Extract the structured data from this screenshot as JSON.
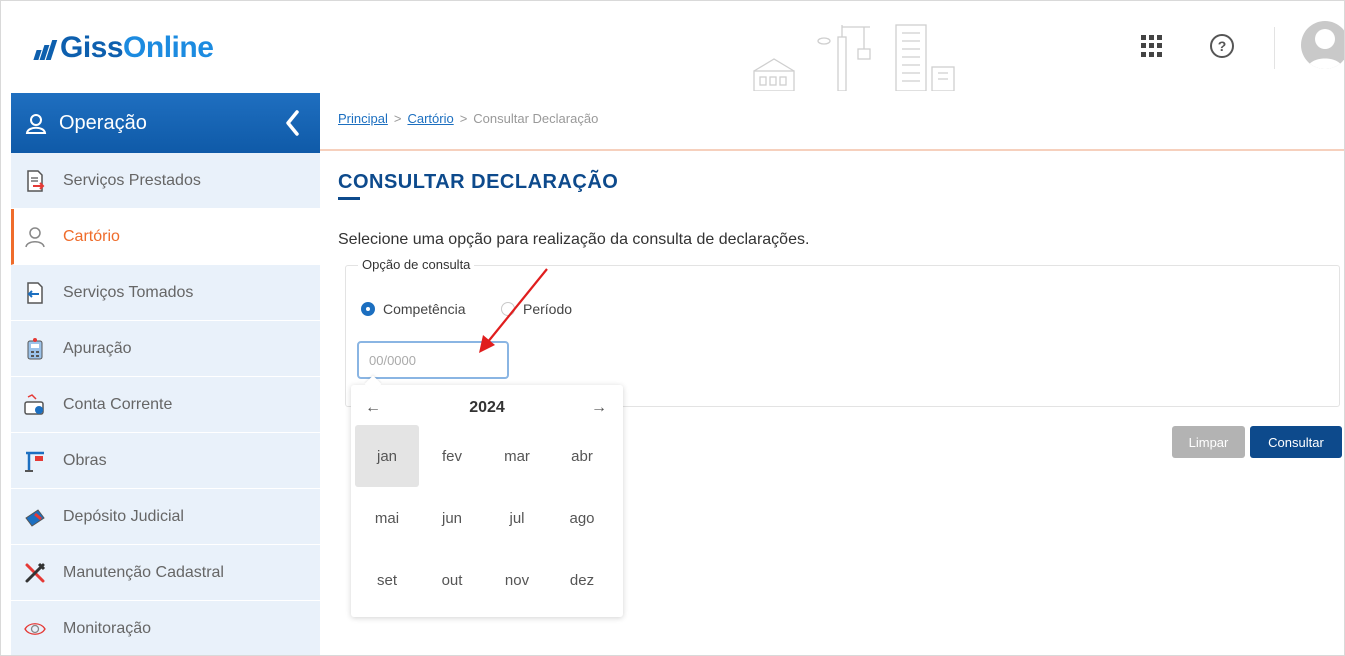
{
  "header": {
    "logo_prefix": "Giss",
    "logo_suffix": "Online",
    "apps_icon": "grid-icon",
    "help_label": "?",
    "avatar_icon": "user-avatar"
  },
  "sidebar": {
    "section_label": "Operação",
    "items": [
      {
        "label": "Serviços Prestados",
        "icon": "document-arrow-icon",
        "active": false
      },
      {
        "label": "Cartório",
        "icon": "person-icon",
        "active": true
      },
      {
        "label": "Serviços Tomados",
        "icon": "document-arrow-in-icon",
        "active": false
      },
      {
        "label": "Apuração",
        "icon": "calculator-icon",
        "active": false
      },
      {
        "label": "Conta Corrente",
        "icon": "wallet-icon",
        "active": false
      },
      {
        "label": "Obras",
        "icon": "crane-icon",
        "active": false
      },
      {
        "label": "Depósito Judicial",
        "icon": "gavel-icon",
        "active": false
      },
      {
        "label": "Manutenção Cadastral",
        "icon": "tools-icon",
        "active": false
      },
      {
        "label": "Monitoração",
        "icon": "eye-icon",
        "active": false
      }
    ]
  },
  "breadcrumb": {
    "home": "Principal",
    "sep": ">",
    "parent": "Cartório",
    "current": "Consultar Declaração"
  },
  "main": {
    "title": "CONSULTAR DECLARAÇÃO",
    "intro": "Selecione uma opção para realização da consulta de declarações.",
    "legend": "Opção de consulta",
    "radio_competencia": "Competência",
    "radio_periodo": "Período",
    "date_placeholder": "00/0000",
    "selected_option": "Competência"
  },
  "picker": {
    "prev": "←",
    "next": "→",
    "year": "2024",
    "months": [
      "jan",
      "fev",
      "mar",
      "abr",
      "mai",
      "jun",
      "jul",
      "ago",
      "set",
      "out",
      "nov",
      "dez"
    ],
    "selected": "jan"
  },
  "buttons": {
    "limpar": "Limpar",
    "consultar": "Consultar"
  },
  "colors": {
    "brand": "#0d5fae",
    "sidebar_head": "#1366b5",
    "active_menu": "#ef6c2b",
    "primary_button": "#0d4a8c",
    "annotation": "#e01e1e"
  }
}
